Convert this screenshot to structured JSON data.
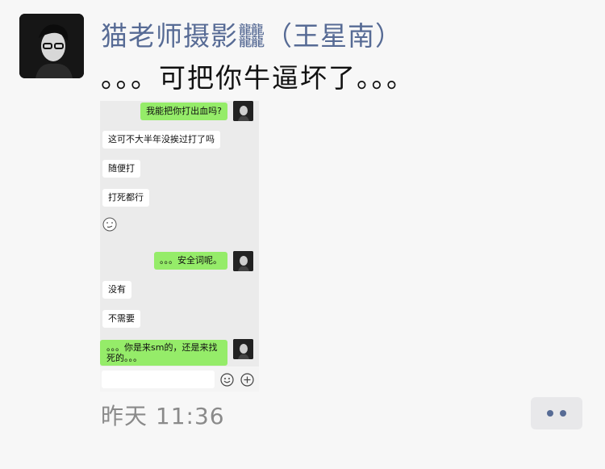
{
  "post": {
    "author": "猫老师摄影𪚥（王星南）",
    "text": "。。。可把你牛逼坏了。。。",
    "timestamp": "昨天 11:36",
    "more_icon": "more-options-icon"
  },
  "screenshot": {
    "messages": [
      {
        "side": "out",
        "text": "我能把你打出血吗?"
      },
      {
        "side": "in",
        "text": "这可不大半年没挨过打了吗"
      },
      {
        "side": "in",
        "text": "随便打"
      },
      {
        "side": "in",
        "text": "打死都行"
      },
      {
        "side": "in",
        "emoji": "smirk-emoji-icon"
      },
      {
        "side": "out",
        "text": "。。。安全词呢。"
      },
      {
        "side": "in",
        "text": "没有"
      },
      {
        "side": "in",
        "text": "不需要"
      },
      {
        "side": "out",
        "text": "。。。你是来sm的，还是来找\n死的。。。"
      }
    ],
    "input_icons": [
      "emoji-icon",
      "plus-icon"
    ]
  },
  "colors": {
    "author": "#576b95",
    "outgoing_bubble": "#95ec69",
    "incoming_bubble": "#ffffff"
  }
}
